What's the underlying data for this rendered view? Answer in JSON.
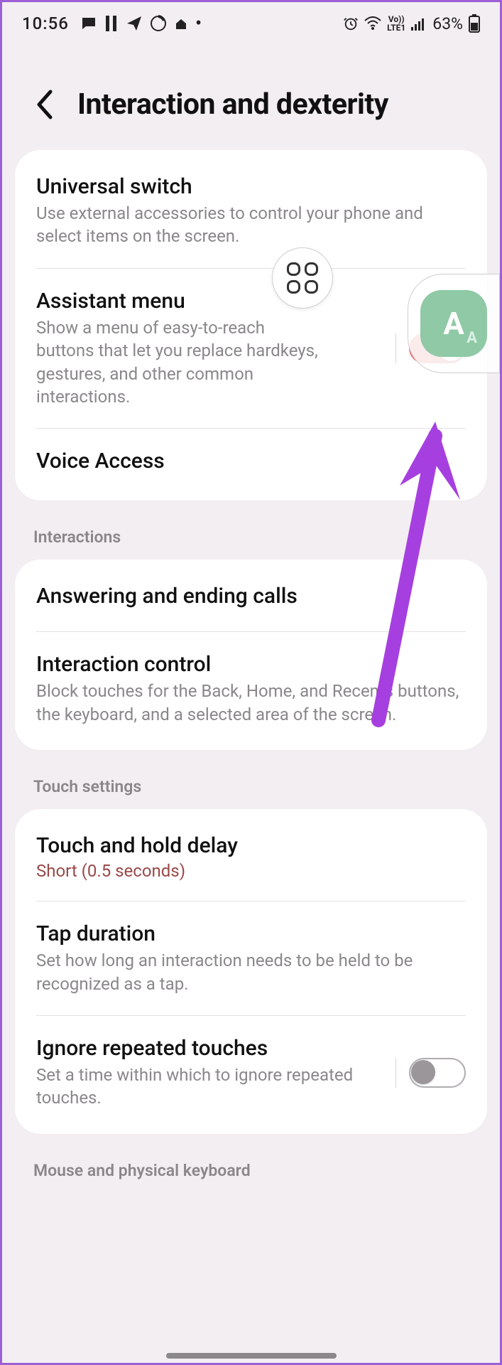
{
  "status": {
    "time": "10:56",
    "battery": "63%"
  },
  "header": {
    "title": "Interaction and dexterity"
  },
  "group1": {
    "universal_switch": {
      "title": "Universal switch",
      "sub": "Use external accessories to control your phone and select items on the screen."
    },
    "assistant_menu": {
      "title": "Assistant menu",
      "sub": "Show a menu of easy-to-reach buttons that let you replace hardkeys, gestures, and other common interactions."
    },
    "voice_access": {
      "title": "Voice Access"
    }
  },
  "sections": {
    "interactions": "Interactions",
    "touch_settings": "Touch settings",
    "mouse": "Mouse and physical keyboard"
  },
  "group2": {
    "answering": {
      "title": "Answering and ending calls"
    },
    "interaction_control": {
      "title": "Interaction control",
      "sub": "Block touches for the Back, Home, and Recents buttons, the keyboard, and a selected area of the screen."
    }
  },
  "group3": {
    "touch_hold": {
      "title": "Touch and hold delay",
      "value": "Short (0.5 seconds)"
    },
    "tap_duration": {
      "title": "Tap duration",
      "sub": "Set how long an interaction needs to be held to be recognized as a tap."
    },
    "ignore_repeated": {
      "title": "Ignore repeated touches",
      "sub": "Set a time within which to ignore repeated touches."
    }
  }
}
